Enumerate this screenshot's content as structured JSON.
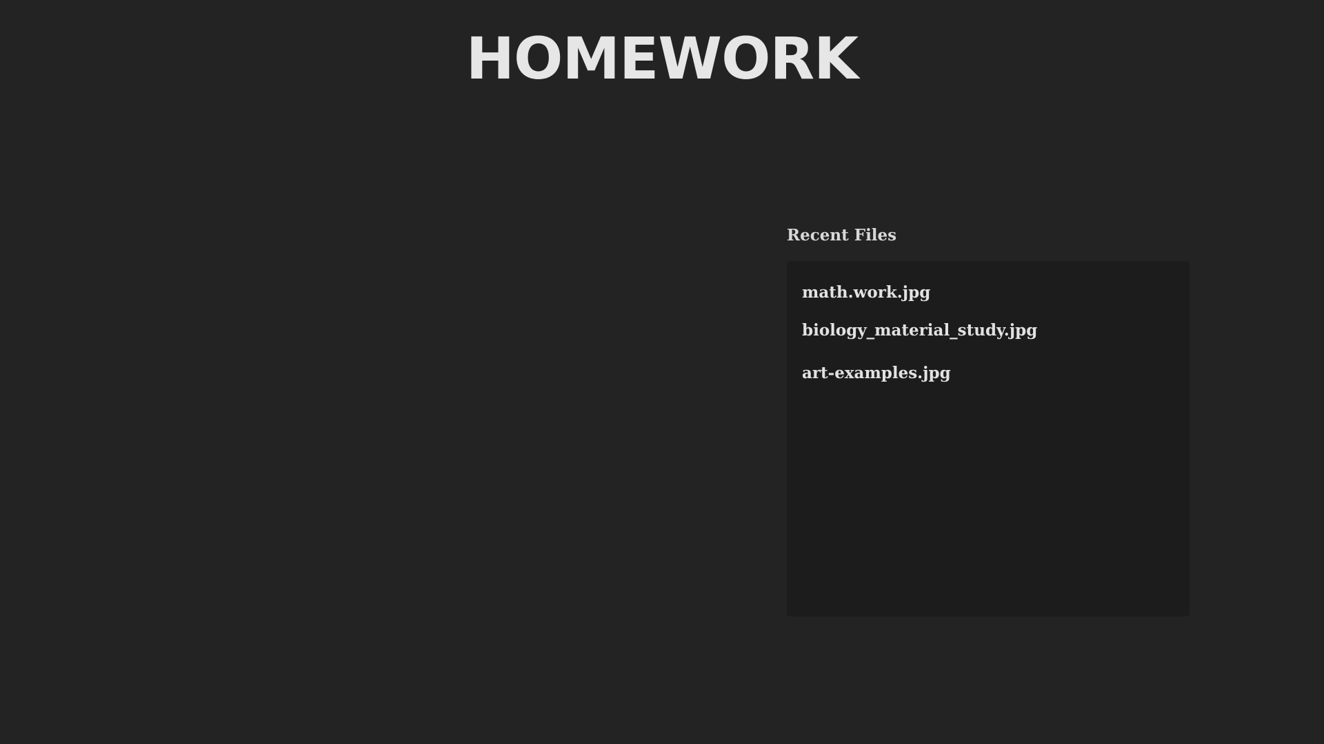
{
  "header": {
    "title": "HOMEWORK"
  },
  "recent_files": {
    "heading": "Recent Files",
    "items": [
      {
        "name": "math.work.jpg"
      },
      {
        "name": "biology_material_study.jpg"
      },
      {
        "name": "art-examples.jpg"
      }
    ]
  },
  "colors": {
    "background": "#232323",
    "panel": "#1c1c1c",
    "text": "#e0e0e0"
  }
}
